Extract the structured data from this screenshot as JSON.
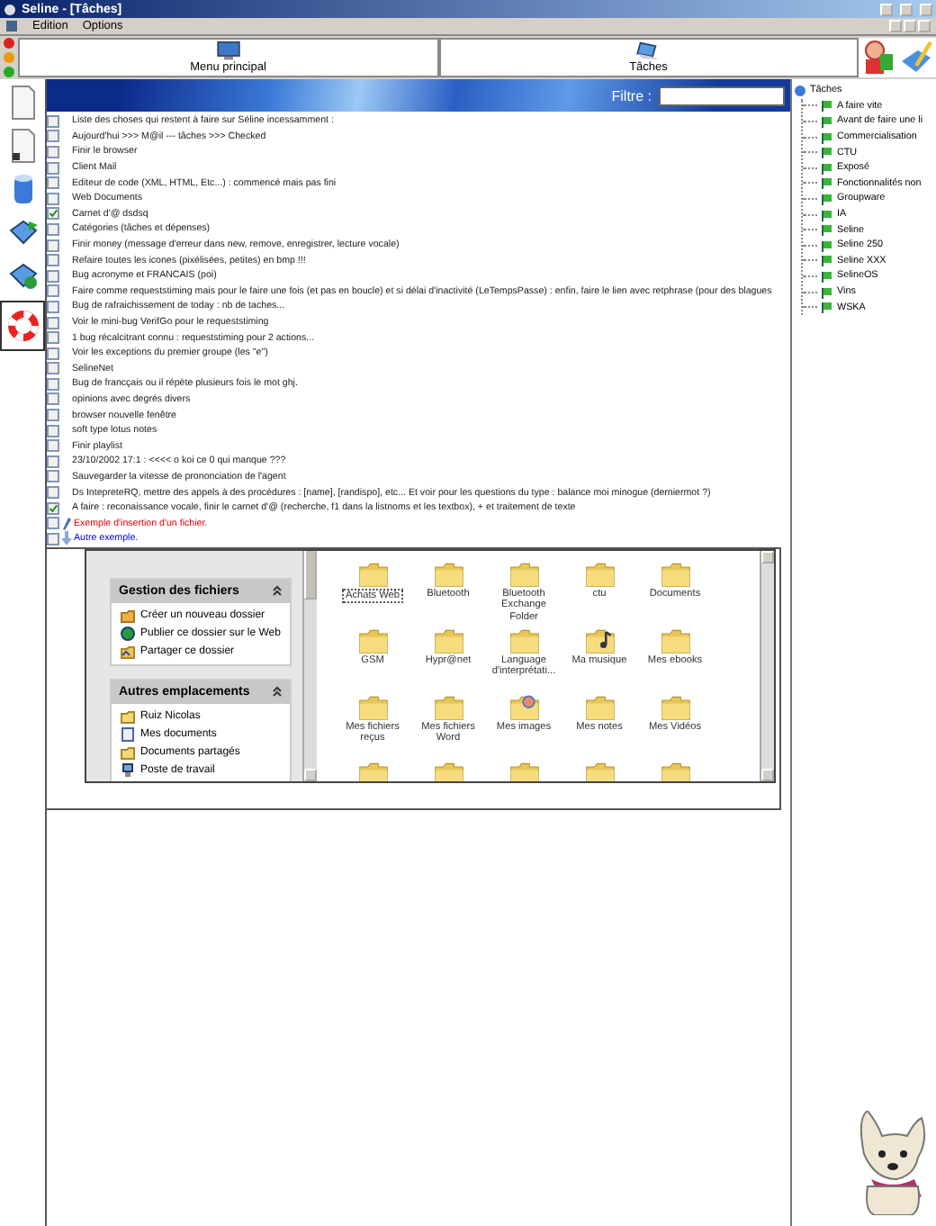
{
  "window": {
    "title": "Seline - [Tâches]"
  },
  "menu": [
    "Edition",
    "Options"
  ],
  "toolbar": [
    {
      "label": "Menu principal",
      "kind": "monitor"
    },
    {
      "label": "Tâches",
      "kind": "laptop"
    }
  ],
  "banner": {
    "filter_label": "Filtre :"
  },
  "tasks": [
    {
      "text": "Liste des choses qui restent à faire sur Séline incessamment :",
      "checked": false,
      "kind": "task"
    },
    {
      "text": "Aujourd'hui >>> M@il  --- tâches >>> Checked",
      "checked": false,
      "kind": "task"
    },
    {
      "text": "Finir le browser",
      "checked": false,
      "kind": "task"
    },
    {
      "text": "Client Mail",
      "checked": false,
      "kind": "task"
    },
    {
      "text": "Editeur de code (XML, HTML, Etc...) : commencé mais pas fini",
      "checked": false,
      "kind": "task"
    },
    {
      "text": "Web Documents",
      "checked": false,
      "kind": "task"
    },
    {
      "text": "Carnet d'@ dsdsq",
      "checked": true,
      "kind": "task"
    },
    {
      "text": "Catégories (tâches et dépenses)",
      "checked": false,
      "kind": "task"
    },
    {
      "text": "Finir money (message d'erreur dans new, remove, enregistrer, lecture vocale)",
      "checked": false,
      "kind": "task"
    },
    {
      "text": "Refaire toutes les icones (pixélisées, petites) en bmp !!!",
      "checked": false,
      "kind": "task"
    },
    {
      "text": "Bug acronyme et FRANCAIS (poi)",
      "checked": false,
      "kind": "task"
    },
    {
      "text": "Faire comme requeststiming mais pour le faire une fois (et pas en boucle) et si délai d'inactivité (LeTempsPasse) : enfin, faire le lien avec retphrase (pour des blagues",
      "checked": false,
      "kind": "task"
    },
    {
      "text": "Bug de rafraichissement de today : nb de taches...",
      "checked": false,
      "kind": "task"
    },
    {
      "text": "Voir le mini-bug VerifGo pour le requeststiming",
      "checked": false,
      "kind": "task"
    },
    {
      "text": "1 bug récalcitrant connu : requeststiming pour 2 actions...",
      "checked": false,
      "kind": "task"
    },
    {
      "text": "Voir les exceptions du premier groupe (les \"e\")",
      "checked": false,
      "kind": "task"
    },
    {
      "text": "SelineNet",
      "checked": false,
      "kind": "task"
    },
    {
      "text": "Bug de francçais ou il répète plusieurs fois le mot ghj.",
      "checked": false,
      "kind": "task"
    },
    {
      "text": "opinions avec degrés divers",
      "checked": false,
      "kind": "task"
    },
    {
      "text": "browser nouvelle fenêtre",
      "checked": false,
      "kind": "task"
    },
    {
      "text": "soft type lotus notes",
      "checked": false,
      "kind": "task"
    },
    {
      "text": "Finir playlist",
      "checked": false,
      "kind": "task"
    },
    {
      "text": "23/10/2002 17:1 : <<<< o koi ce 0 qui manque ???",
      "checked": false,
      "kind": "task"
    },
    {
      "text": "Sauvegarder la vitesse de prononciation de l'agent",
      "checked": false,
      "kind": "task"
    },
    {
      "text": "Ds IntepreteRQ, mettre des appels à des procédures : [name], [randispo], etc... Et voir pour les questions du type : balance moi minogue (derniermot ?)",
      "checked": false,
      "kind": "task"
    },
    {
      "text": "A faire : reconaissance vocale, finir le carnet d'@ (recherche, f1 dans la listnoms et les textbox), + et traitement de texte",
      "checked": true,
      "kind": "task"
    },
    {
      "text": "Exemple d'insertion d'un fichier.",
      "checked": false,
      "kind": "note"
    },
    {
      "text": "Autre exemple.",
      "checked": false,
      "kind": "attachment"
    }
  ],
  "explorer": {
    "sections": [
      {
        "title": "Gestion des fichiers",
        "items": [
          {
            "label": "Créer un nouveau dossier",
            "kind": "newfolder"
          },
          {
            "label": "Publier ce dossier sur le Web",
            "kind": "globe"
          },
          {
            "label": "Partager ce dossier",
            "kind": "share"
          }
        ]
      },
      {
        "title": "Autres emplacements",
        "items": [
          {
            "label": "Ruiz Nicolas",
            "kind": "folder"
          },
          {
            "label": "Mes documents",
            "kind": "docs"
          },
          {
            "label": "Documents partagés",
            "kind": "folder"
          },
          {
            "label": "Poste de travail",
            "kind": "computer"
          }
        ]
      }
    ],
    "folders": [
      {
        "label": "Achats Web",
        "selected": true,
        "kind": "folder"
      },
      {
        "label": "Bluetooth",
        "selected": false,
        "kind": "folder"
      },
      {
        "label": "Bluetooth Exchange Folder",
        "selected": false,
        "kind": "folder"
      },
      {
        "label": "ctu",
        "selected": false,
        "kind": "folder"
      },
      {
        "label": "Documents",
        "selected": false,
        "kind": "folder"
      },
      {
        "label": "GSM",
        "selected": false,
        "kind": "folder"
      },
      {
        "label": "Hypr@net",
        "selected": false,
        "kind": "folder"
      },
      {
        "label": "Language d'interprétati...",
        "selected": false,
        "kind": "folder"
      },
      {
        "label": "Ma musique",
        "selected": false,
        "kind": "music"
      },
      {
        "label": "Mes ebooks",
        "selected": false,
        "kind": "folder"
      },
      {
        "label": "Mes fichiers reçus",
        "selected": false,
        "kind": "folder"
      },
      {
        "label": "Mes fichiers Word",
        "selected": false,
        "kind": "folder"
      },
      {
        "label": "Mes images",
        "selected": false,
        "kind": "pictures"
      },
      {
        "label": "Mes notes",
        "selected": false,
        "kind": "folder"
      },
      {
        "label": "Mes Vidéos",
        "selected": false,
        "kind": "folder"
      }
    ]
  },
  "tree": {
    "label": "Tâches",
    "children": [
      {
        "label": "A faire vite"
      },
      {
        "label": "Avant de faire une li"
      },
      {
        "label": "Commercialisation"
      },
      {
        "label": "CTU"
      },
      {
        "label": "Exposé"
      },
      {
        "label": "Fonctionnalités non"
      },
      {
        "label": "Groupware"
      },
      {
        "label": "IA"
      },
      {
        "label": "Seline"
      },
      {
        "label": "Seline 250"
      },
      {
        "label": "Seline XXX"
      },
      {
        "label": "SelineOS"
      },
      {
        "label": "Vins"
      },
      {
        "label": "WSKA"
      }
    ]
  }
}
